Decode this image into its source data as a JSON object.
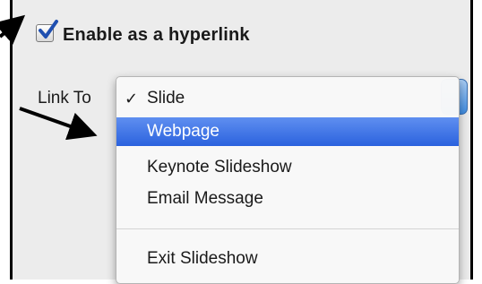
{
  "checkbox": {
    "label": "Enable as a hyperlink",
    "checked": true
  },
  "link_to": {
    "label": "Link To"
  },
  "menu": {
    "items": [
      {
        "label": "Slide",
        "checked": true,
        "check_mark": "✓",
        "highlighted": false
      },
      {
        "label": "Webpage",
        "checked": false,
        "highlighted": true
      },
      {
        "label": "Keynote Slideshow",
        "checked": false,
        "highlighted": false
      },
      {
        "label": "Email Message",
        "checked": false,
        "highlighted": false
      },
      {
        "label": "Exit Slideshow",
        "checked": false,
        "highlighted": false
      }
    ]
  },
  "colors": {
    "highlight": "#2b62de",
    "check": "#1f4fb0",
    "annotation_arrow": "#000000"
  },
  "icons": [
    "checkmark-icon",
    "callout-arrow-icon"
  ]
}
